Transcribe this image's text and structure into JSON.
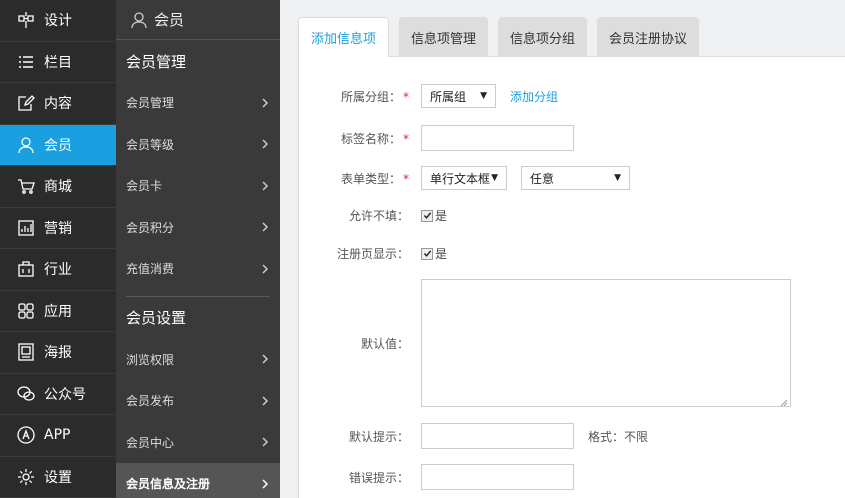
{
  "primary_nav": [
    {
      "label": "设计",
      "icon": "design-icon"
    },
    {
      "label": "栏目",
      "icon": "list-icon"
    },
    {
      "label": "内容",
      "icon": "edit-icon"
    },
    {
      "label": "会员",
      "icon": "user-icon",
      "active": true
    },
    {
      "label": "商城",
      "icon": "cart-icon"
    },
    {
      "label": "营销",
      "icon": "chart-icon"
    },
    {
      "label": "行业",
      "icon": "bag-icon"
    },
    {
      "label": "应用",
      "icon": "apps-icon"
    },
    {
      "label": "海报",
      "icon": "poster-icon"
    },
    {
      "label": "公众号",
      "icon": "wechat-icon"
    },
    {
      "label": "APP",
      "icon": "app-store-icon"
    },
    {
      "label": "设置",
      "icon": "gear-icon"
    }
  ],
  "secondary_nav": {
    "header": "会员",
    "section1": "会员管理",
    "group1": [
      "会员管理",
      "会员等级",
      "会员卡",
      "会员积分",
      "充值消费"
    ],
    "section2": "会员设置",
    "group2": [
      "浏览权限",
      "会员发布",
      "会员中心",
      "会员信息及注册"
    ]
  },
  "tabs": [
    "添加信息项",
    "信息项管理",
    "信息项分组",
    "会员注册协议"
  ],
  "form": {
    "group_label": "所属分组：",
    "group_value": "所属组",
    "add_group": "添加分组",
    "tag_label": "标签名称：",
    "form_type_label": "表单类型：",
    "form_type_value": "单行文本框",
    "any_value": "任意",
    "allow_empty_label": "允许不填：",
    "allow_empty_check": "是",
    "reg_show_label": "注册页显示：",
    "reg_show_check": "是",
    "default_label": "默认值：",
    "default_hint_label": "默认提示：",
    "format_hint": "格式：不限",
    "error_hint_label": "错误提示："
  },
  "colors": {
    "accent": "#1a9fe0",
    "nav_bg": "#2b2b2b",
    "subnav_bg": "#3a3a3a"
  }
}
